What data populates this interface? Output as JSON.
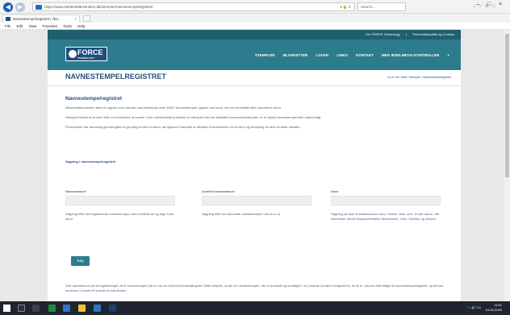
{
  "browser": {
    "address": "https://www.edelmetalkontrollen.dk/stempler/navnestempelregistret/",
    "address_controls": "▾ 🔒 C",
    "search_placeholder": "Search...",
    "tab_label": "Navnestempelregistret | Æd...",
    "tab_close": "×",
    "menu": [
      "File",
      "Edit",
      "View",
      "Favorites",
      "Tools",
      "Help"
    ],
    "window_controls": [
      "–",
      "□",
      "×"
    ]
  },
  "site": {
    "top_links": [
      "Om FORCE Technology",
      "Persondatapolitik og Cookies"
    ],
    "logo_text": "FORCE",
    "logo_sub": "TECHNOLOGY",
    "nav": [
      "STEMPLER",
      "BLANKETTER",
      "LOVEN",
      "LINKS",
      "KONTAKT",
      "MED ÆDELMETALKONTROLLEN",
      "⌕"
    ],
    "page_title": "NAVNESTEMPELREGISTRET",
    "breadcrumb": "Du er her: Start / Stempler / Navnestempelregistret"
  },
  "content": {
    "heading": "Navnestempelregistret",
    "paragraphs": [
      "Ædelmetalkontrollen fører et register over danske navnestempler efter 1893. Navnestempler oplyser om hvem, der har fremstillet eller importeret varen.",
      "Stemplet består af et navn eller en forkortelse af navnet. Hvis udenlandske produkter er stemplet med de såkaldte konventionsstempler, er et dansk navnestempel ikke nødvendigt.",
      "Producenter har ansvarlig gennemgået en grundig kontrol af varen, før ligesom Danmark er tilsluttet Konventionen om Kontrol og stempling af varer af ædle metaller."
    ],
    "search_link": "Søgning i navnestempelregistret"
  },
  "form": {
    "fields": [
      {
        "label": "Navnestempel",
        "help": "Søgning efter det registrerede navnestempel uden mellemrum og tegn f.eks. abcd"
      },
      {
        "label": "Anmeldt navnestempel",
        "help": "Søgning efter det anmeldte navnestempel f.eks a.b.c.d"
      },
      {
        "label": "Navn",
        "help": "Søgning på dele af butiksnavnes navn. Skriver f.eks. urer, vil alle navne, der indeholder denne tegnkombination fremkomme, f.eks. Hansen og Jensen."
      }
    ],
    "submit_label": "Søg"
  },
  "footer_text": "Vær opmærksom på at registreringen af et navnestempel har en vis om end kort behandlingstid. Dette betyder, at der for navnestempler, der er anmeldt og modtaget, i en periode vil være mulighed for, at de er i proces ikke tilføjet til navnestempelregistret, og derved forsinkes i forhold til hvornår de kan findes.",
  "taskbar": {
    "tray_text": "^ ⌂ 🔊 DA",
    "time": "11:51",
    "date": "24-04-2020"
  },
  "colors": {
    "header": "#2d7c8d",
    "top_links_bg": "#1f5f6e",
    "title": "#2a4d7a"
  }
}
